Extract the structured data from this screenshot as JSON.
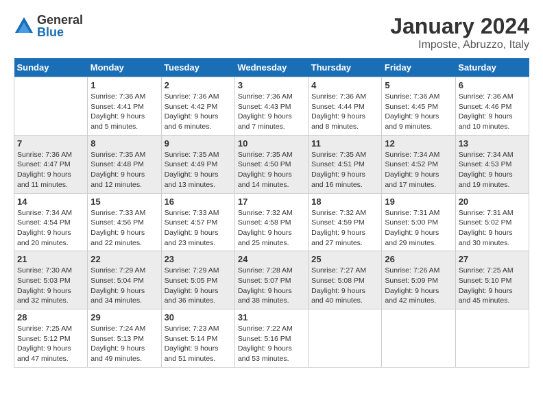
{
  "logo": {
    "general": "General",
    "blue": "Blue"
  },
  "title": "January 2024",
  "location": "Imposte, Abruzzo, Italy",
  "days_of_week": [
    "Sunday",
    "Monday",
    "Tuesday",
    "Wednesday",
    "Thursday",
    "Friday",
    "Saturday"
  ],
  "weeks": [
    [
      {
        "day": "",
        "info": ""
      },
      {
        "day": "1",
        "info": "Sunrise: 7:36 AM\nSunset: 4:41 PM\nDaylight: 9 hours\nand 5 minutes."
      },
      {
        "day": "2",
        "info": "Sunrise: 7:36 AM\nSunset: 4:42 PM\nDaylight: 9 hours\nand 6 minutes."
      },
      {
        "day": "3",
        "info": "Sunrise: 7:36 AM\nSunset: 4:43 PM\nDaylight: 9 hours\nand 7 minutes."
      },
      {
        "day": "4",
        "info": "Sunrise: 7:36 AM\nSunset: 4:44 PM\nDaylight: 9 hours\nand 8 minutes."
      },
      {
        "day": "5",
        "info": "Sunrise: 7:36 AM\nSunset: 4:45 PM\nDaylight: 9 hours\nand 9 minutes."
      },
      {
        "day": "6",
        "info": "Sunrise: 7:36 AM\nSunset: 4:46 PM\nDaylight: 9 hours\nand 10 minutes."
      }
    ],
    [
      {
        "day": "7",
        "info": "Sunrise: 7:36 AM\nSunset: 4:47 PM\nDaylight: 9 hours\nand 11 minutes."
      },
      {
        "day": "8",
        "info": "Sunrise: 7:35 AM\nSunset: 4:48 PM\nDaylight: 9 hours\nand 12 minutes."
      },
      {
        "day": "9",
        "info": "Sunrise: 7:35 AM\nSunset: 4:49 PM\nDaylight: 9 hours\nand 13 minutes."
      },
      {
        "day": "10",
        "info": "Sunrise: 7:35 AM\nSunset: 4:50 PM\nDaylight: 9 hours\nand 14 minutes."
      },
      {
        "day": "11",
        "info": "Sunrise: 7:35 AM\nSunset: 4:51 PM\nDaylight: 9 hours\nand 16 minutes."
      },
      {
        "day": "12",
        "info": "Sunrise: 7:34 AM\nSunset: 4:52 PM\nDaylight: 9 hours\nand 17 minutes."
      },
      {
        "day": "13",
        "info": "Sunrise: 7:34 AM\nSunset: 4:53 PM\nDaylight: 9 hours\nand 19 minutes."
      }
    ],
    [
      {
        "day": "14",
        "info": "Sunrise: 7:34 AM\nSunset: 4:54 PM\nDaylight: 9 hours\nand 20 minutes."
      },
      {
        "day": "15",
        "info": "Sunrise: 7:33 AM\nSunset: 4:56 PM\nDaylight: 9 hours\nand 22 minutes."
      },
      {
        "day": "16",
        "info": "Sunrise: 7:33 AM\nSunset: 4:57 PM\nDaylight: 9 hours\nand 23 minutes."
      },
      {
        "day": "17",
        "info": "Sunrise: 7:32 AM\nSunset: 4:58 PM\nDaylight: 9 hours\nand 25 minutes."
      },
      {
        "day": "18",
        "info": "Sunrise: 7:32 AM\nSunset: 4:59 PM\nDaylight: 9 hours\nand 27 minutes."
      },
      {
        "day": "19",
        "info": "Sunrise: 7:31 AM\nSunset: 5:00 PM\nDaylight: 9 hours\nand 29 minutes."
      },
      {
        "day": "20",
        "info": "Sunrise: 7:31 AM\nSunset: 5:02 PM\nDaylight: 9 hours\nand 30 minutes."
      }
    ],
    [
      {
        "day": "21",
        "info": "Sunrise: 7:30 AM\nSunset: 5:03 PM\nDaylight: 9 hours\nand 32 minutes."
      },
      {
        "day": "22",
        "info": "Sunrise: 7:29 AM\nSunset: 5:04 PM\nDaylight: 9 hours\nand 34 minutes."
      },
      {
        "day": "23",
        "info": "Sunrise: 7:29 AM\nSunset: 5:05 PM\nDaylight: 9 hours\nand 36 minutes."
      },
      {
        "day": "24",
        "info": "Sunrise: 7:28 AM\nSunset: 5:07 PM\nDaylight: 9 hours\nand 38 minutes."
      },
      {
        "day": "25",
        "info": "Sunrise: 7:27 AM\nSunset: 5:08 PM\nDaylight: 9 hours\nand 40 minutes."
      },
      {
        "day": "26",
        "info": "Sunrise: 7:26 AM\nSunset: 5:09 PM\nDaylight: 9 hours\nand 42 minutes."
      },
      {
        "day": "27",
        "info": "Sunrise: 7:25 AM\nSunset: 5:10 PM\nDaylight: 9 hours\nand 45 minutes."
      }
    ],
    [
      {
        "day": "28",
        "info": "Sunrise: 7:25 AM\nSunset: 5:12 PM\nDaylight: 9 hours\nand 47 minutes."
      },
      {
        "day": "29",
        "info": "Sunrise: 7:24 AM\nSunset: 5:13 PM\nDaylight: 9 hours\nand 49 minutes."
      },
      {
        "day": "30",
        "info": "Sunrise: 7:23 AM\nSunset: 5:14 PM\nDaylight: 9 hours\nand 51 minutes."
      },
      {
        "day": "31",
        "info": "Sunrise: 7:22 AM\nSunset: 5:16 PM\nDaylight: 9 hours\nand 53 minutes."
      },
      {
        "day": "",
        "info": ""
      },
      {
        "day": "",
        "info": ""
      },
      {
        "day": "",
        "info": ""
      }
    ]
  ]
}
